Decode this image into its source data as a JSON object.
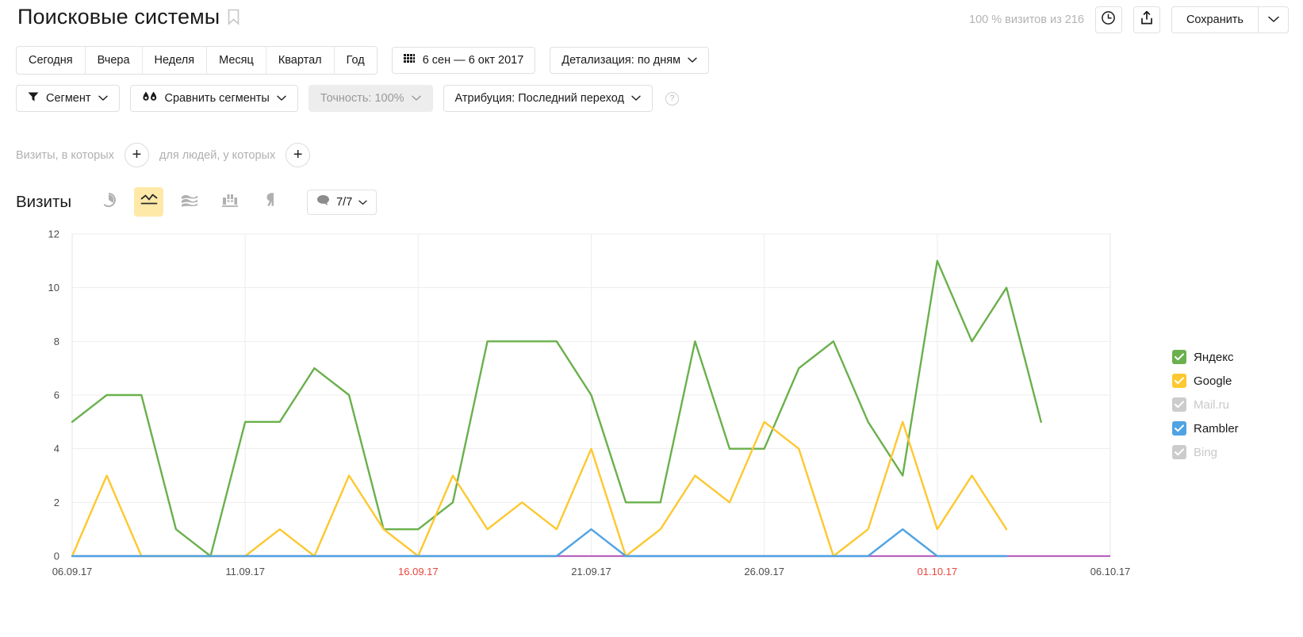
{
  "header": {
    "title": "Поисковые системы",
    "bookmark_icon": "bookmark-icon",
    "visits_summary": "100 % визитов из 216",
    "history_icon": "clock-icon",
    "export_icon": "export-icon",
    "save_label": "Сохранить",
    "save_caret_icon": "chevron-down-icon"
  },
  "period": {
    "buttons": [
      "Сегодня",
      "Вчера",
      "Неделя",
      "Месяц",
      "Квартал",
      "Год"
    ],
    "date_range": "6 сен — 6 окт 2017",
    "calendar_icon": "calendar-icon",
    "detail": "Детализация: по дням",
    "detail_caret_icon": "chevron-down-icon"
  },
  "segment_row": {
    "segment": "Сегмент",
    "segment_icon": "funnel-icon",
    "compare": "Сравнить сегменты",
    "compare_icon": "compare-drops-icon",
    "accuracy": "Точность: 100%",
    "attribution": "Атрибуция: Последний переход",
    "help_icon": "question-icon",
    "caret_icon": "chevron-down-icon"
  },
  "filter_row": {
    "visits_label": "Визиты, в которых",
    "people_label": "для людей, у которых",
    "add_icon": "plus-icon"
  },
  "metric_row": {
    "metric": "Визиты",
    "views": [
      {
        "name": "pie-chart-icon",
        "active": false
      },
      {
        "name": "line-chart-icon",
        "active": true
      },
      {
        "name": "stacked-area-icon",
        "active": false
      },
      {
        "name": "bar-chart-icon",
        "active": false
      },
      {
        "name": "map-pin-icon",
        "active": false
      }
    ],
    "comments": "7/7",
    "comment_icon": "speech-bubble-icon",
    "comment_caret_icon": "chevron-down-icon"
  },
  "chart_data": {
    "type": "line",
    "title": "Визиты",
    "xlabel": "",
    "ylabel": "",
    "ylim": [
      0,
      12
    ],
    "yticks": [
      0,
      2,
      4,
      6,
      8,
      10,
      12
    ],
    "grid": true,
    "legend_position": "right",
    "x": [
      "06.09.17",
      "07.09.17",
      "08.09.17",
      "09.09.17",
      "10.09.17",
      "11.09.17",
      "12.09.17",
      "13.09.17",
      "14.09.17",
      "15.09.17",
      "16.09.17",
      "17.09.17",
      "18.09.17",
      "19.09.17",
      "20.09.17",
      "21.09.17",
      "22.09.17",
      "23.09.17",
      "24.09.17",
      "25.09.17",
      "26.09.17",
      "27.09.17",
      "28.09.17",
      "29.09.17",
      "30.09.17",
      "01.10.17",
      "02.10.17",
      "03.10.17",
      "04.10.17",
      "05.10.17",
      "06.10.17"
    ],
    "xticks": [
      {
        "label": "06.09.17",
        "index": 0,
        "weekend": false
      },
      {
        "label": "11.09.17",
        "index": 5,
        "weekend": false
      },
      {
        "label": "16.09.17",
        "index": 10,
        "weekend": true
      },
      {
        "label": "21.09.17",
        "index": 15,
        "weekend": false
      },
      {
        "label": "26.09.17",
        "index": 20,
        "weekend": false
      },
      {
        "label": "01.10.17",
        "index": 25,
        "weekend": true
      },
      {
        "label": "06.10.17",
        "index": 30,
        "weekend": false
      }
    ],
    "series": [
      {
        "name": "Яндекс",
        "color": "#6ab04c",
        "enabled": true,
        "values": [
          5,
          6,
          6,
          1,
          0,
          5,
          5,
          7,
          6,
          1,
          1,
          2,
          8,
          8,
          8,
          6,
          2,
          2,
          8,
          4,
          4,
          7,
          8,
          5,
          3,
          11,
          8,
          10,
          5,
          null,
          null
        ]
      },
      {
        "name": "Google",
        "color": "#fdc830",
        "enabled": true,
        "values": [
          0,
          3,
          0,
          0,
          0,
          0,
          1,
          0,
          3,
          1,
          0,
          3,
          1,
          2,
          1,
          4,
          0,
          1,
          3,
          2,
          5,
          4,
          0,
          1,
          5,
          1,
          3,
          1,
          null,
          null,
          null
        ]
      },
      {
        "name": "Mail.ru",
        "color": "#cccccc",
        "enabled": false,
        "values": []
      },
      {
        "name": "Rambler",
        "color": "#4fa3e3",
        "enabled": true,
        "values": [
          0,
          0,
          0,
          0,
          0,
          0,
          0,
          0,
          0,
          0,
          0,
          0,
          0,
          0,
          0,
          1,
          0,
          0,
          0,
          0,
          0,
          0,
          0,
          0,
          1,
          0,
          0,
          0,
          null,
          null,
          null
        ]
      },
      {
        "name": "Bing",
        "color": "#cccccc",
        "enabled": false,
        "values": []
      }
    ],
    "baseline_color": "#b863c0"
  },
  "legend": {
    "items": [
      {
        "label": "Яндекс",
        "color": "#6ab04c",
        "enabled": true
      },
      {
        "label": "Google",
        "color": "#fdc830",
        "enabled": true
      },
      {
        "label": "Mail.ru",
        "color": "#cccccc",
        "enabled": false
      },
      {
        "label": "Rambler",
        "color": "#4fa3e3",
        "enabled": true
      },
      {
        "label": "Bing",
        "color": "#cccccc",
        "enabled": false
      }
    ]
  }
}
